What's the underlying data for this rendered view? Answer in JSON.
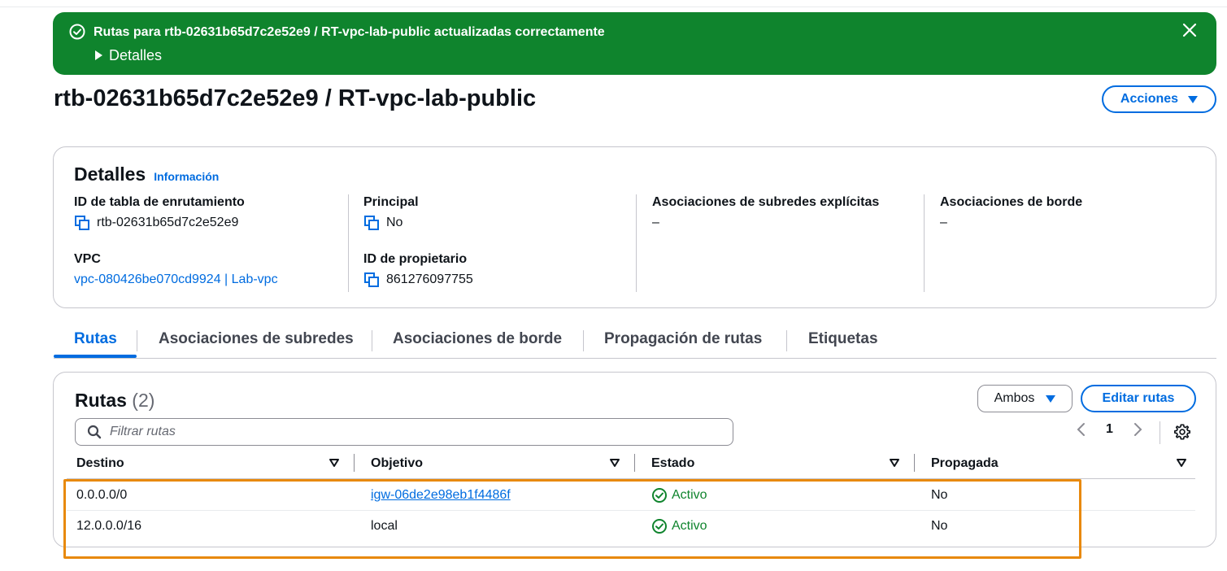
{
  "flash": {
    "message": "Rutas para rtb-02631b65d7c2e52e9 / RT-vpc-lab-public actualizadas correctamente",
    "details_label": "Detalles",
    "bg_color": "#0f842d"
  },
  "page": {
    "title": "rtb-02631b65d7c2e52e9 / RT-vpc-lab-public",
    "actions_label": "Acciones"
  },
  "details": {
    "heading": "Detalles",
    "info_link": "Información",
    "fields": {
      "route_table_id": {
        "label": "ID de tabla de enrutamiento",
        "value": "rtb-02631b65d7c2e52e9"
      },
      "vpc": {
        "label": "VPC",
        "value": "vpc-080426be070cd9924 | Lab-vpc"
      },
      "main": {
        "label": "Principal",
        "value": "No"
      },
      "owner_id": {
        "label": "ID de propietario",
        "value": "861276097755"
      },
      "explicit_subnet_assoc": {
        "label": "Asociaciones de subredes explícitas",
        "value": "–"
      },
      "edge_assoc": {
        "label": "Asociaciones de borde",
        "value": "–"
      }
    }
  },
  "tabs": [
    {
      "label": "Rutas",
      "active": true
    },
    {
      "label": "Asociaciones de subredes",
      "active": false
    },
    {
      "label": "Asociaciones de borde",
      "active": false
    },
    {
      "label": "Propagación de rutas",
      "active": false
    },
    {
      "label": "Etiquetas",
      "active": false
    }
  ],
  "routes": {
    "heading": "Rutas",
    "count": "(2)",
    "filter_select": "Ambos",
    "edit_label": "Editar rutas",
    "search_placeholder": "Filtrar rutas",
    "page_number": "1",
    "columns": [
      "Destino",
      "Objetivo",
      "Estado",
      "Propagada"
    ],
    "rows": [
      {
        "destination": "0.0.0.0/0",
        "target": "igw-06de2e98eb1f4486f",
        "status": "Activo",
        "propagated": "No"
      },
      {
        "destination": "12.0.0.0/16",
        "target": "local",
        "status": "Activo",
        "propagated": "No"
      }
    ]
  },
  "colors": {
    "accent": "#006ce0",
    "success": "#0f842d",
    "highlight": "#e8890c"
  }
}
